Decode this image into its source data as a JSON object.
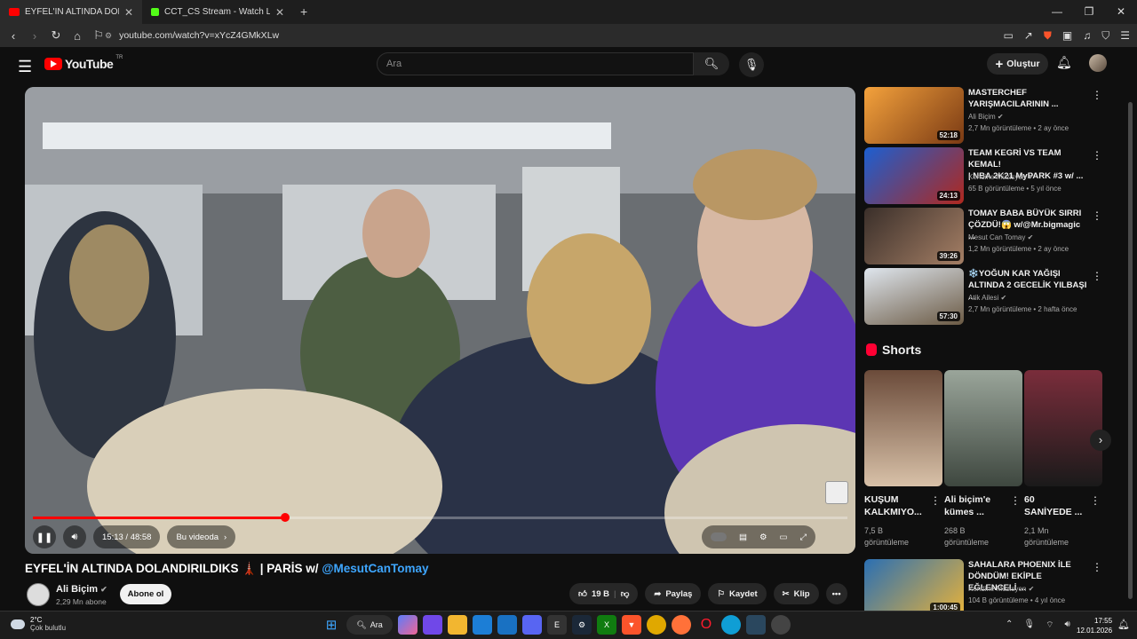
{
  "browser": {
    "tabs": [
      {
        "label": "EYFEL'İN ALTINDA DOLANDIR",
        "active": true
      },
      {
        "label": "CCT_CS Stream - Watch Live on Kick",
        "active": false
      }
    ],
    "new_tab": "+",
    "url": "youtube.com/watch?v=xYcZ4GMkXLw"
  },
  "youtube": {
    "logo": "YouTube",
    "region": "TR",
    "search_placeholder": "Ara",
    "create_label": "Oluştur"
  },
  "player": {
    "time": "15:13 / 48:58",
    "chapter": "Bu videoda",
    "progress": 0.31
  },
  "video": {
    "title": "EYFEL'İN ALTINDA DOLANDIRILDIKS 🗼 | PARİS w/",
    "mention": "@MesutCanTomay",
    "channel": "Ali Biçim",
    "subscribers": "2,29 Mn abone",
    "subscribe_label": "Abone ol",
    "likes": "19 B",
    "share": "Paylaş",
    "save": "Kaydet",
    "clip": "Klip"
  },
  "recommendations": [
    {
      "title": "MASTERCHEF\nYARIŞMACILARININ ...",
      "channel": "Ali Biçim",
      "meta": "2,7 Mn görüntüleme • 2 ay önce",
      "duration": "52:18"
    },
    {
      "title": "TEAM KEGRİ VS TEAM KEMAL!\n| NBA 2K21 MyPARK #3 w/ ...",
      "channel": "Kendine Müzisyen",
      "meta": "65 B görüntüleme • 5 yıl önce",
      "duration": "24:13"
    },
    {
      "title": "TOMAY BABA BÜYÜK SIRRI\nÇÖZDÜ!😱 w/@Mr.bigmagic ...",
      "channel": "Mesut Can Tomay",
      "meta": "1,2 Mn görüntüleme • 2 ay önce",
      "duration": "39:26"
    },
    {
      "title": "❄️YOĞUN KAR YAĞIŞI\nALTINDA 2 GECELİK YILBAŞI ...",
      "channel": "Atik Ailesi",
      "meta": "2,7 Mn görüntüleme • 2 hafta önce",
      "duration": "57:30"
    }
  ],
  "shorts": {
    "heading": "Shorts",
    "items": [
      {
        "title": "KUŞUM\nKALKMIYO...",
        "views": "7,5 B\ngörüntüleme"
      },
      {
        "title": "Ali biçim'e\nkümes ...",
        "views": "268 B\ngörüntüleme"
      },
      {
        "title": "60\nSANİYEDE ...",
        "views": "2,1 Mn\ngörüntüleme"
      }
    ]
  },
  "rec5": {
    "title": "SAHALARA PHOENIX İLE\nDÖNDÜM! EKİPLE EĞLENCELİ ...",
    "channel": "Kendine Müzisyen",
    "meta": "104 B görüntüleme • 4 yıl önce",
    "duration": "1:00:45"
  },
  "taskbar": {
    "temperature": "2°C",
    "weather": "Çok bulutlu",
    "search": "Ara",
    "time": "17:55",
    "date": "12.01.2026"
  },
  "colors": {
    "accent": "#ff0000",
    "link": "#3ea6ff",
    "background": "#0f0f0f"
  }
}
